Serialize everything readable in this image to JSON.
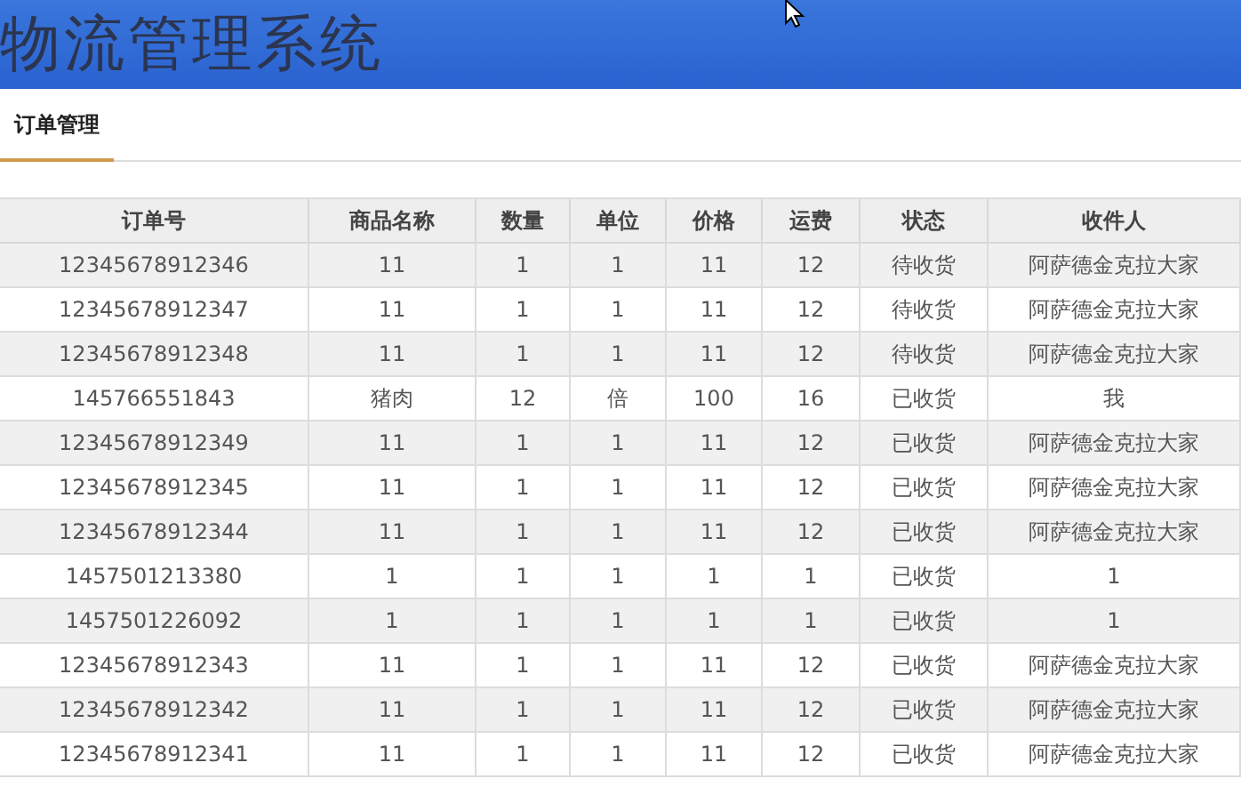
{
  "header": {
    "title": "物流管理系统"
  },
  "tabs": [
    {
      "label": "订单管理",
      "selected": true
    }
  ],
  "table": {
    "columns": [
      "订单号",
      "商品名称",
      "数量",
      "单位",
      "价格",
      "运费",
      "状态",
      "收件人"
    ],
    "rows": [
      {
        "cells": [
          "12345678912346",
          "11",
          "1",
          "1",
          "11",
          "12",
          "待收货",
          "阿萨德金克拉大家"
        ]
      },
      {
        "cells": [
          "12345678912347",
          "11",
          "1",
          "1",
          "11",
          "12",
          "待收货",
          "阿萨德金克拉大家"
        ]
      },
      {
        "cells": [
          "12345678912348",
          "11",
          "1",
          "1",
          "11",
          "12",
          "待收货",
          "阿萨德金克拉大家"
        ]
      },
      {
        "cells": [
          "145766551843",
          "猪肉",
          "12",
          "倍",
          "100",
          "16",
          "已收货",
          "我"
        ]
      },
      {
        "cells": [
          "12345678912349",
          "11",
          "1",
          "1",
          "11",
          "12",
          "已收货",
          "阿萨德金克拉大家"
        ]
      },
      {
        "cells": [
          "12345678912345",
          "11",
          "1",
          "1",
          "11",
          "12",
          "已收货",
          "阿萨德金克拉大家"
        ]
      },
      {
        "cells": [
          "12345678912344",
          "11",
          "1",
          "1",
          "11",
          "12",
          "已收货",
          "阿萨德金克拉大家"
        ]
      },
      {
        "cells": [
          "1457501213380",
          "1",
          "1",
          "1",
          "1",
          "1",
          "已收货",
          "1"
        ]
      },
      {
        "cells": [
          "1457501226092",
          "1",
          "1",
          "1",
          "1",
          "1",
          "已收货",
          "1"
        ]
      },
      {
        "cells": [
          "12345678912343",
          "11",
          "1",
          "1",
          "11",
          "12",
          "已收货",
          "阿萨德金克拉大家"
        ]
      },
      {
        "cells": [
          "12345678912342",
          "11",
          "1",
          "1",
          "11",
          "12",
          "已收货",
          "阿萨德金克拉大家"
        ]
      },
      {
        "cells": [
          "12345678912341",
          "11",
          "1",
          "1",
          "11",
          "12",
          "已收货",
          "阿萨德金克拉大家"
        ]
      }
    ]
  }
}
